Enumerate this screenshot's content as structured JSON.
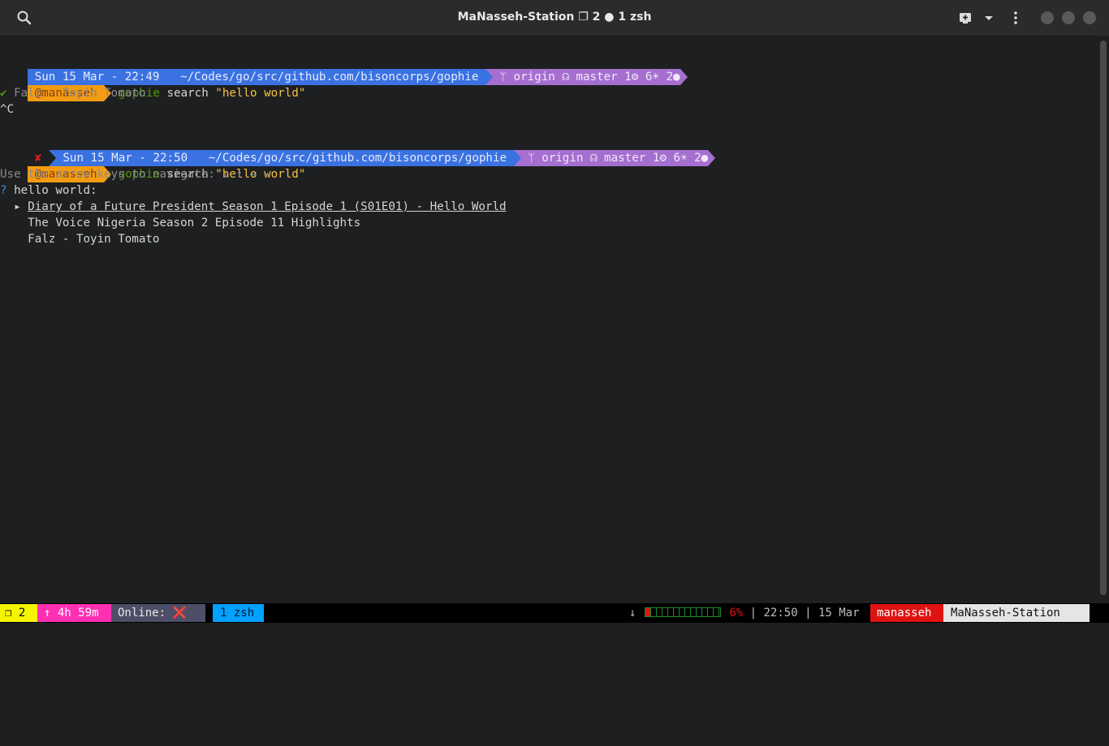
{
  "window": {
    "title": "MaNasseh-Station ❐ 2 ● 1 zsh"
  },
  "prompt1": {
    "date": "Sun 15 Mar - 22:49",
    "path": "~/Codes/go/src/github.com/bisoncorps/gophie",
    "git": "origin ☊ master 1⚙ 6☀ 2●",
    "user": "@manasseh",
    "cmd_name": "gophie",
    "cmd_arg": "search",
    "cmd_str": "\"hello world\""
  },
  "output1": {
    "result": "Falz - Toyin Tomato",
    "interrupt": "^C"
  },
  "prompt2": {
    "date": "Sun 15 Mar - 22:50",
    "path": "~/Codes/go/src/github.com/bisoncorps/gophie",
    "git": "origin ☊ master 1⚙ 6☀ 2●",
    "user": "@manasseh",
    "cmd_name": "gophie",
    "cmd_arg": "search",
    "cmd_str": "\"hello world\""
  },
  "menu": {
    "hint": "Use the arrow keys to navigate: ↓ ↑ → ←",
    "question_mark": "?",
    "question": "hello world:",
    "cursor": "▸",
    "items": [
      "Diary of a Future President Season 1 Episode 1 (S01E01) - Hello World",
      "The Voice Nigeria Season 2 Episode 11 Highlights",
      "Falz - Toyin Tomato"
    ]
  },
  "statusbar": {
    "windows": "❐ 2",
    "uptime": "↑ 4h 59m",
    "online_label": "Online:",
    "online_icon": "❌",
    "session": "1 zsh",
    "down_arrow": "↓",
    "battery_pct": "6%",
    "battery_level": 0.06,
    "sep1": "|",
    "time": "22:50",
    "sep2": "|",
    "date": "15 Mar",
    "user": "manasseh",
    "host": "MaNasseh-Station"
  },
  "colors": {
    "date_segment": "#3b72e2",
    "git_segment": "#a56fd0",
    "user_segment": "#f39c12"
  }
}
